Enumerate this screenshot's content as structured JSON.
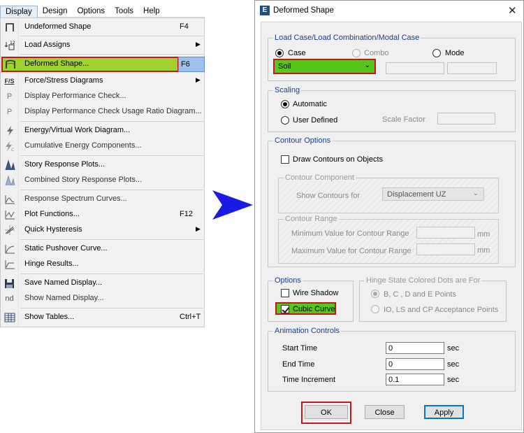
{
  "menubar": [
    "Display",
    "Design",
    "Options",
    "Tools",
    "Help"
  ],
  "menu_items": [
    {
      "label": "Undeformed Shape",
      "shortcut": "F4",
      "icon": "undeformed-shape-icon"
    },
    {
      "label": "Load Assigns",
      "submenu": true,
      "icon": "load-assigns-icon"
    },
    {
      "label": "Deformed Shape...",
      "shortcut": "F6",
      "icon": "deformed-shape-icon",
      "highlighted": true
    },
    {
      "label": "Force/Stress Diagrams",
      "submenu": true,
      "icon": "force-stress-icon",
      "icon_text": "F/S"
    },
    {
      "label": "Display Performance Check...",
      "icon": "performance-check-icon",
      "icon_text": "P"
    },
    {
      "label": "Display Performance Check Usage Ratio Diagram...",
      "icon": "usage-ratio-icon",
      "icon_text": "P"
    },
    {
      "label": "Energy/Virtual Work Diagram...",
      "icon": "energy-icon"
    },
    {
      "label": "Cumulative Energy Components...",
      "icon": "cumulative-energy-icon"
    },
    {
      "label": "Story Response Plots...",
      "icon": "story-response-icon"
    },
    {
      "label": "Combined Story Response Plots...",
      "icon": "combined-story-icon"
    },
    {
      "label": "Response Spectrum Curves...",
      "icon": "response-spectrum-icon"
    },
    {
      "label": "Plot Functions...",
      "shortcut": "F12",
      "icon": "plot-functions-icon"
    },
    {
      "label": "Quick Hysteresis",
      "submenu": true,
      "icon": "hysteresis-icon"
    },
    {
      "label": "Static Pushover Curve...",
      "icon": "pushover-icon"
    },
    {
      "label": "Hinge Results...",
      "icon": "hinge-results-icon"
    },
    {
      "label": "Save Named Display...",
      "icon": "save-icon"
    },
    {
      "label": "Show Named Display...",
      "icon": "named-display-icon",
      "icon_text": "nd"
    },
    {
      "label": "Show Tables...",
      "shortcut": "Ctrl+T",
      "icon": "tables-icon"
    }
  ],
  "dialog": {
    "title": "Deformed Shape",
    "load_case": {
      "group_title": "Load Case/Load Combination/Modal Case",
      "case_label": "Case",
      "combo_label": "Combo",
      "mode_label": "Mode",
      "case_value": "Soil"
    },
    "scaling": {
      "group_title": "Scaling",
      "automatic_label": "Automatic",
      "user_defined_label": "User Defined",
      "scale_factor_label": "Scale Factor"
    },
    "contour": {
      "group_title": "Contour Options",
      "draw_label": "Draw Contours on Objects",
      "component_title": "Contour Component",
      "show_for_label": "Show Contours for",
      "show_for_value": "Displacement UZ",
      "range_title": "Contour Range",
      "min_label": "Minimum Value for Contour Range",
      "max_label": "Maximum Value for Contour Range",
      "unit": "mm"
    },
    "options": {
      "group_title": "Options",
      "wire_shadow_label": "Wire Shadow",
      "cubic_curve_label": "Cubic Curve"
    },
    "hinge": {
      "group_title": "Hinge State Colored Dots are For",
      "opt1": "B, C , D and E Points",
      "opt2": "IO, LS and CP Acceptance Points"
    },
    "animation": {
      "group_title": "Animation Controls",
      "start_label": "Start Time",
      "start_value": "0",
      "end_label": "End Time",
      "end_value": "0",
      "inc_label": "Time Increment",
      "inc_value": "0.1",
      "unit": "sec"
    },
    "buttons": {
      "ok": "OK",
      "close": "Close",
      "apply": "Apply"
    }
  },
  "colors": {
    "highlight_green": "#57c71d",
    "menu_green": "#9fd22f",
    "annotation_red": "#c4161c",
    "arrow_blue": "#1a1ae6"
  }
}
